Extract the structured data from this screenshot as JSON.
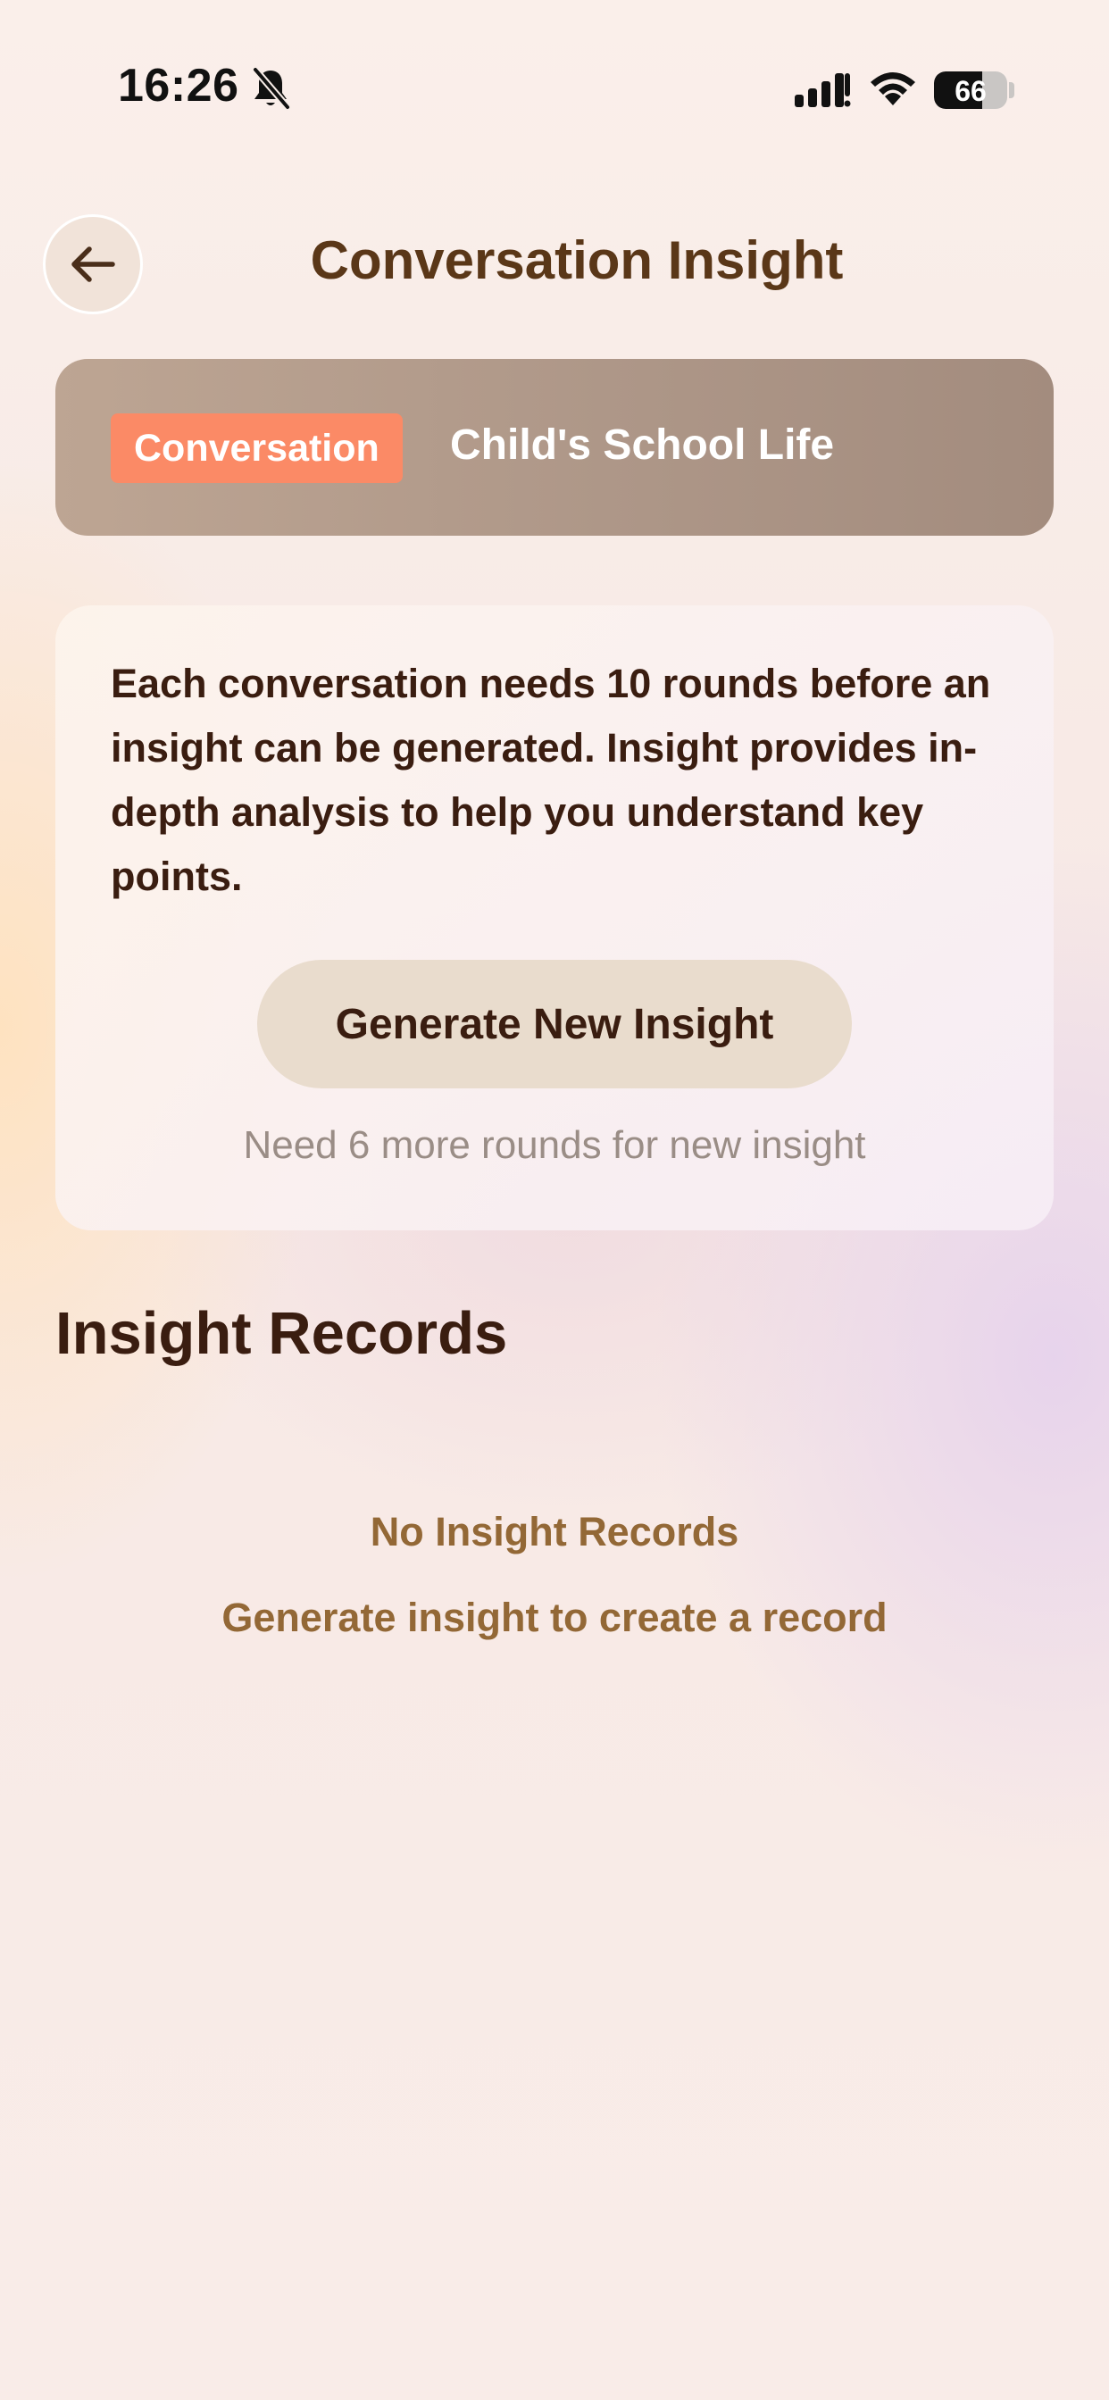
{
  "status_bar": {
    "time": "16:26",
    "battery_level": "66",
    "battery_fraction": 0.66
  },
  "header": {
    "title": "Conversation Insight",
    "back_icon": "arrow-left-icon"
  },
  "topic": {
    "badge": "Conversation",
    "title": "Child's School Life"
  },
  "info_card": {
    "description": "Each conversation needs 10 rounds before an insight can be generated. Insight provides in-depth analysis to help you understand key points.",
    "generate_button": "Generate New Insight",
    "rounds_note": "Need 6 more rounds for new insight"
  },
  "records": {
    "heading": "Insight Records",
    "empty_title": "No Insight Records",
    "empty_subtitle": "Generate insight to create a record"
  },
  "colors": {
    "accent_badge": "#fb8a66",
    "title_brown": "#5a3718",
    "text_dark": "#3a1d10",
    "empty_text": "#936836",
    "button_bg": "#e9dccd"
  }
}
